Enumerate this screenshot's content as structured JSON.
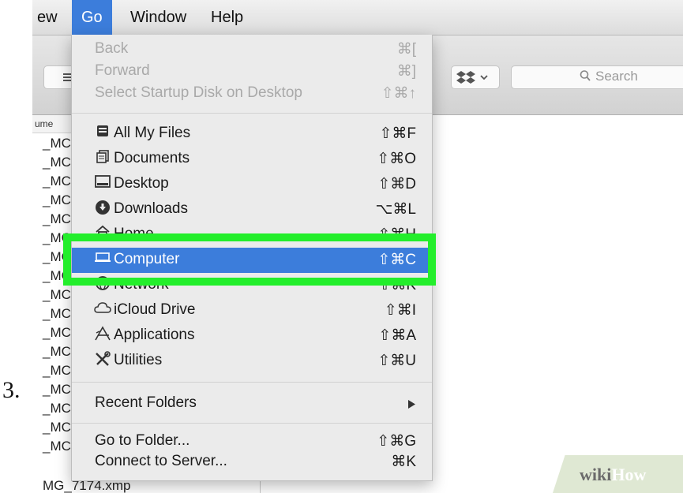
{
  "step_number": "3.",
  "menubar": {
    "items": [
      {
        "label": "ew"
      },
      {
        "label": "Go"
      },
      {
        "label": "Window"
      },
      {
        "label": "Help"
      }
    ]
  },
  "toolbar": {
    "view_icon": "list-view-icon",
    "dropbox_icon": "dropbox-icon",
    "search_placeholder": "Search"
  },
  "file_list": {
    "header": "ume",
    "rows": [
      "_MC",
      "_MC",
      "_MC",
      "_MC",
      "_MC",
      "_MC",
      "_MC",
      "_MC",
      "_MC",
      "_MC",
      "_MC",
      "_MC",
      "_MC",
      "_MC",
      "_MC",
      "_MC",
      "_MC",
      "MG_7174.xmp"
    ]
  },
  "go_menu": {
    "back": {
      "label": "Back",
      "shortcut": "⌘["
    },
    "forward": {
      "label": "Forward",
      "shortcut": "⌘]"
    },
    "startup_disk": {
      "label": "Select Startup Disk on Desktop",
      "shortcut": "⇧⌘↑"
    },
    "all_my_files": {
      "label": "All My Files",
      "shortcut": "⇧⌘F",
      "icon": "all-files-icon"
    },
    "documents": {
      "label": "Documents",
      "shortcut": "⇧⌘O",
      "icon": "documents-icon"
    },
    "desktop": {
      "label": "Desktop",
      "shortcut": "⇧⌘D",
      "icon": "desktop-icon"
    },
    "downloads": {
      "label": "Downloads",
      "shortcut": "⌥⌘L",
      "icon": "downloads-icon"
    },
    "home": {
      "label": "Home",
      "shortcut": "⇧⌘H",
      "icon": "home-icon"
    },
    "computer": {
      "label": "Computer",
      "shortcut": "⇧⌘C",
      "icon": "computer-icon"
    },
    "network": {
      "label": "Network",
      "shortcut": "⇧⌘K",
      "icon": "network-icon"
    },
    "icloud_drive": {
      "label": "iCloud Drive",
      "shortcut": "⇧⌘I",
      "icon": "cloud-icon"
    },
    "applications": {
      "label": "Applications",
      "shortcut": "⇧⌘A",
      "icon": "applications-icon"
    },
    "utilities": {
      "label": "Utilities",
      "shortcut": "⇧⌘U",
      "icon": "utilities-icon"
    },
    "recent_folders": {
      "label": "Recent Folders",
      "submenu_icon": "submenu-arrow-icon"
    },
    "go_to_folder": {
      "label": "Go to Folder...",
      "shortcut": "⇧⌘G"
    },
    "connect_to_server": {
      "label": "Connect to Server...",
      "shortcut": "⌘K"
    }
  },
  "annotation_color": "#23ee2b",
  "highlight_color": "#3c7ddb",
  "watermark": {
    "part1": "wiki",
    "part2": "How"
  }
}
